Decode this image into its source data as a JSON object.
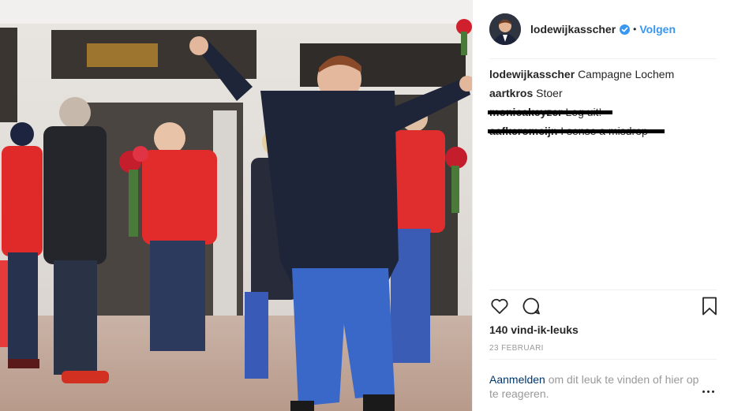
{
  "post": {
    "username": "lodewijkasscher",
    "follow_label": "Volgen",
    "separator": "•",
    "verified_icon": "verified-badge-icon",
    "accent_color": "#3897f0"
  },
  "comments": [
    {
      "user": "lodewijkasscher",
      "text": "Campagne Lochem",
      "redacted": false
    },
    {
      "user": "aartkros",
      "text": "Stoer",
      "redacted": false
    },
    {
      "user": "monicakeyzer",
      "text": "Leg uit!",
      "redacted": true
    },
    {
      "user": "aafkeromeijn",
      "text": "I sense a misdrop",
      "redacted": true
    }
  ],
  "actions": {
    "like_icon": "heart-icon",
    "comment_icon": "comment-bubble-icon",
    "save_icon": "bookmark-icon"
  },
  "likes": "140 vind-ik-leuks",
  "date": "23 FEBRUARI",
  "login_prompt": {
    "link": "Aanmelden",
    "text": " om dit leuk te vinden of hier op te reageren."
  },
  "more_icon": "more-options-icon"
}
